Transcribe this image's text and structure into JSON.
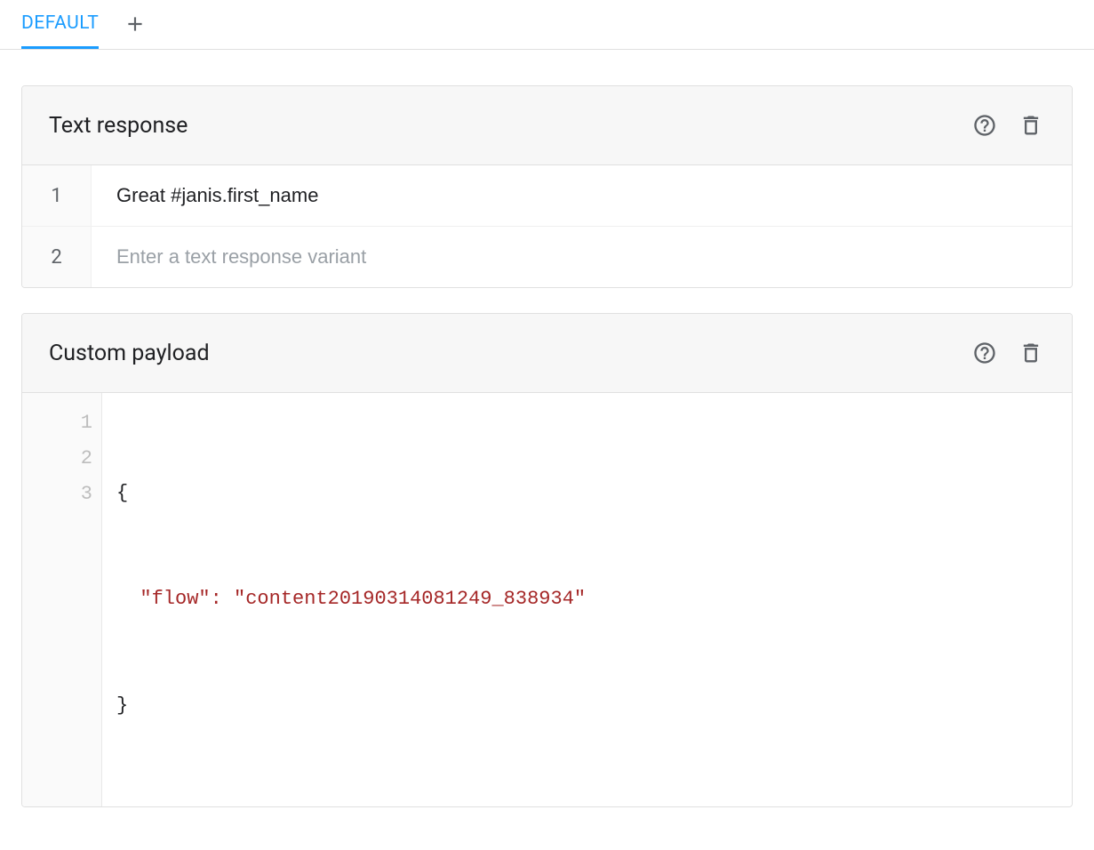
{
  "tabs": {
    "active": "DEFAULT"
  },
  "textResponse": {
    "title": "Text response",
    "rows": [
      {
        "num": "1",
        "value": "Great #janis.first_name"
      },
      {
        "num": "2",
        "value": "",
        "placeholder": "Enter a text response variant"
      }
    ]
  },
  "customPayload": {
    "title": "Custom payload",
    "lines": [
      "1",
      "2",
      "3"
    ],
    "json": {
      "key": "\"flow\"",
      "value": "\"content20190314081249_838934\""
    }
  }
}
